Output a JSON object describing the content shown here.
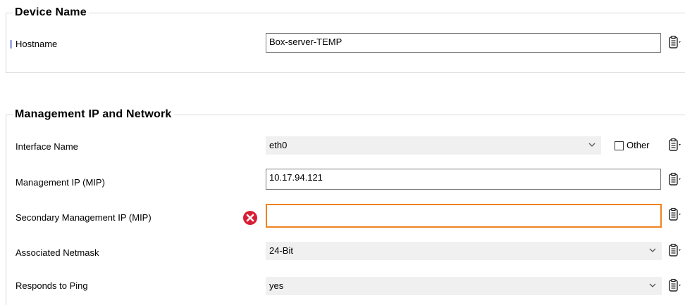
{
  "device_name_group": {
    "title": "Device Name",
    "hostname": {
      "label": "Hostname",
      "value": "Box-server-TEMP"
    }
  },
  "management_group": {
    "title": "Management IP and Network",
    "interface_name": {
      "label": "Interface Name",
      "value": "eth0",
      "other_label": "Other",
      "other_checked": false
    },
    "management_ip": {
      "label": "Management IP (MIP)",
      "value": "10.17.94.121"
    },
    "secondary_management_ip": {
      "label": "Secondary Management IP (MIP)",
      "value": "",
      "has_error": true
    },
    "associated_netmask": {
      "label": "Associated Netmask",
      "value": "24-Bit"
    },
    "responds_to_ping": {
      "label": "Responds to Ping",
      "value": "yes"
    }
  },
  "icons": {
    "clipboard": "clipboard-menu-icon",
    "error": "error-x-icon",
    "dropdown": "chevron-down-icon"
  },
  "colors": {
    "error_border": "#f0821e",
    "error_icon": "#d81e34",
    "required_marker": "#a3aee0"
  }
}
